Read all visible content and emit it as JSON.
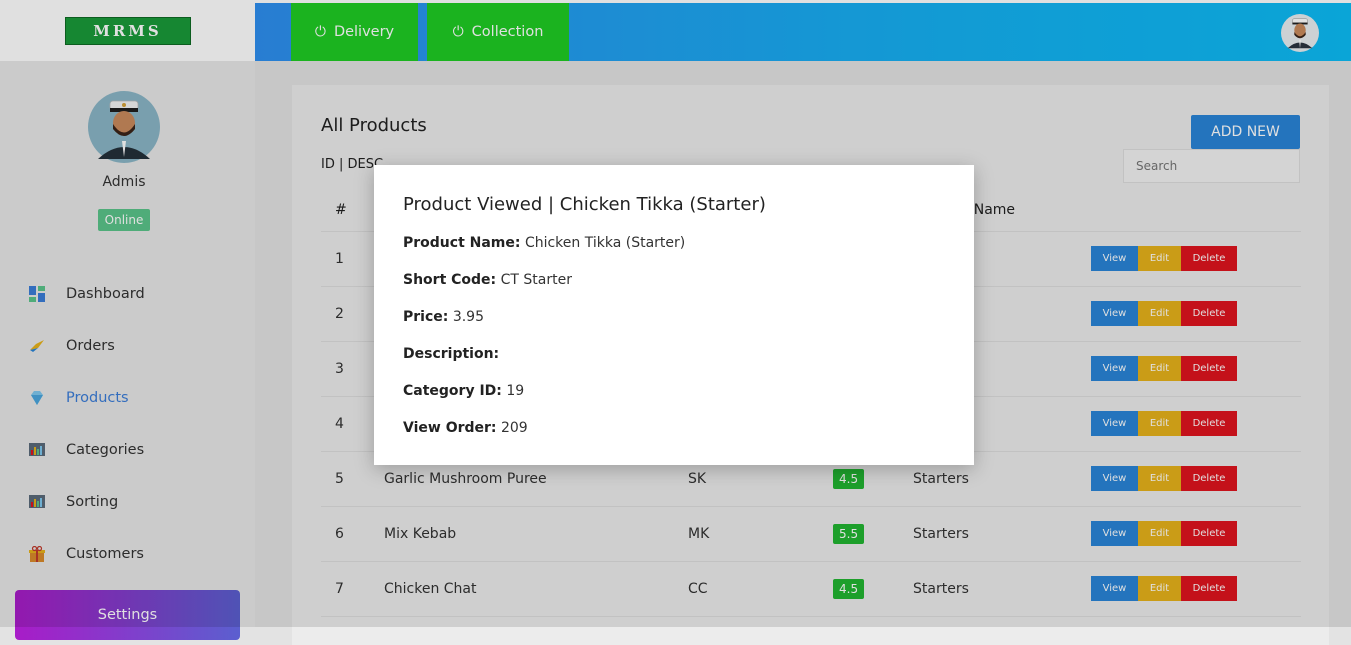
{
  "brand": {
    "logo_text": "MRMS",
    "logo_color": "#1a9a3a"
  },
  "topbar": {
    "buttons": [
      {
        "label": "Delivery",
        "icon": "power-icon"
      },
      {
        "label": "Collection",
        "icon": "power-icon"
      }
    ]
  },
  "sidebar": {
    "user_name": "Admis",
    "status": "Online",
    "items": [
      {
        "label": "Dashboard",
        "icon": "dashboard-icon"
      },
      {
        "label": "Orders",
        "icon": "orders-icon"
      },
      {
        "label": "Products",
        "icon": "diamond-icon",
        "active": true
      },
      {
        "label": "Categories",
        "icon": "chart-icon"
      },
      {
        "label": "Sorting",
        "icon": "chart-icon"
      },
      {
        "label": "Customers",
        "icon": "gift-icon"
      }
    ],
    "settings_label": "Settings"
  },
  "products": {
    "title": "All Products",
    "sort_label": "ID | DESC",
    "add_label": "ADD NEW",
    "search_placeholder": "Search",
    "columns": {
      "num": "#",
      "category": "y Name"
    },
    "rows": [
      {
        "id": "1",
        "name": "",
        "code": "",
        "price": "",
        "category": ""
      },
      {
        "id": "2",
        "name": "",
        "code": "",
        "price": "",
        "category": ""
      },
      {
        "id": "3",
        "name": "",
        "code": "",
        "price": "",
        "category": ""
      },
      {
        "id": "4",
        "name": "",
        "code": "",
        "price": "",
        "category": ""
      },
      {
        "id": "5",
        "name": "Garlic Mushroom Puree",
        "code": "SK",
        "price": "4.5",
        "category": "Starters"
      },
      {
        "id": "6",
        "name": "Mix Kebab",
        "code": "MK",
        "price": "5.5",
        "category": "Starters"
      },
      {
        "id": "7",
        "name": "Chicken Chat",
        "code": "CC",
        "price": "4.5",
        "category": "Starters"
      }
    ],
    "actions": {
      "view": "View",
      "edit": "Edit",
      "delete": "Delete"
    }
  },
  "modal": {
    "title": "Product Viewed | Chicken Tikka (Starter)",
    "fields": [
      {
        "label": "Product Name:",
        "value": "Chicken Tikka (Starter)"
      },
      {
        "label": "Short Code:",
        "value": "CT Starter"
      },
      {
        "label": "Price:",
        "value": "3.95"
      },
      {
        "label": "Description:",
        "value": ""
      },
      {
        "label": "Category ID:",
        "value": "19"
      },
      {
        "label": "View Order:",
        "value": "209"
      }
    ]
  },
  "colors": {
    "topbar_start": "#2e8ff0",
    "topbar_end": "#0cbcf5",
    "toggle_green": "#1fcc24",
    "primary_blue": "#2a85d8",
    "edit_yellow": "#e6b21b",
    "delete_red": "#e0141e",
    "price_green": "#21b531",
    "online_green": "#5bc48a"
  }
}
